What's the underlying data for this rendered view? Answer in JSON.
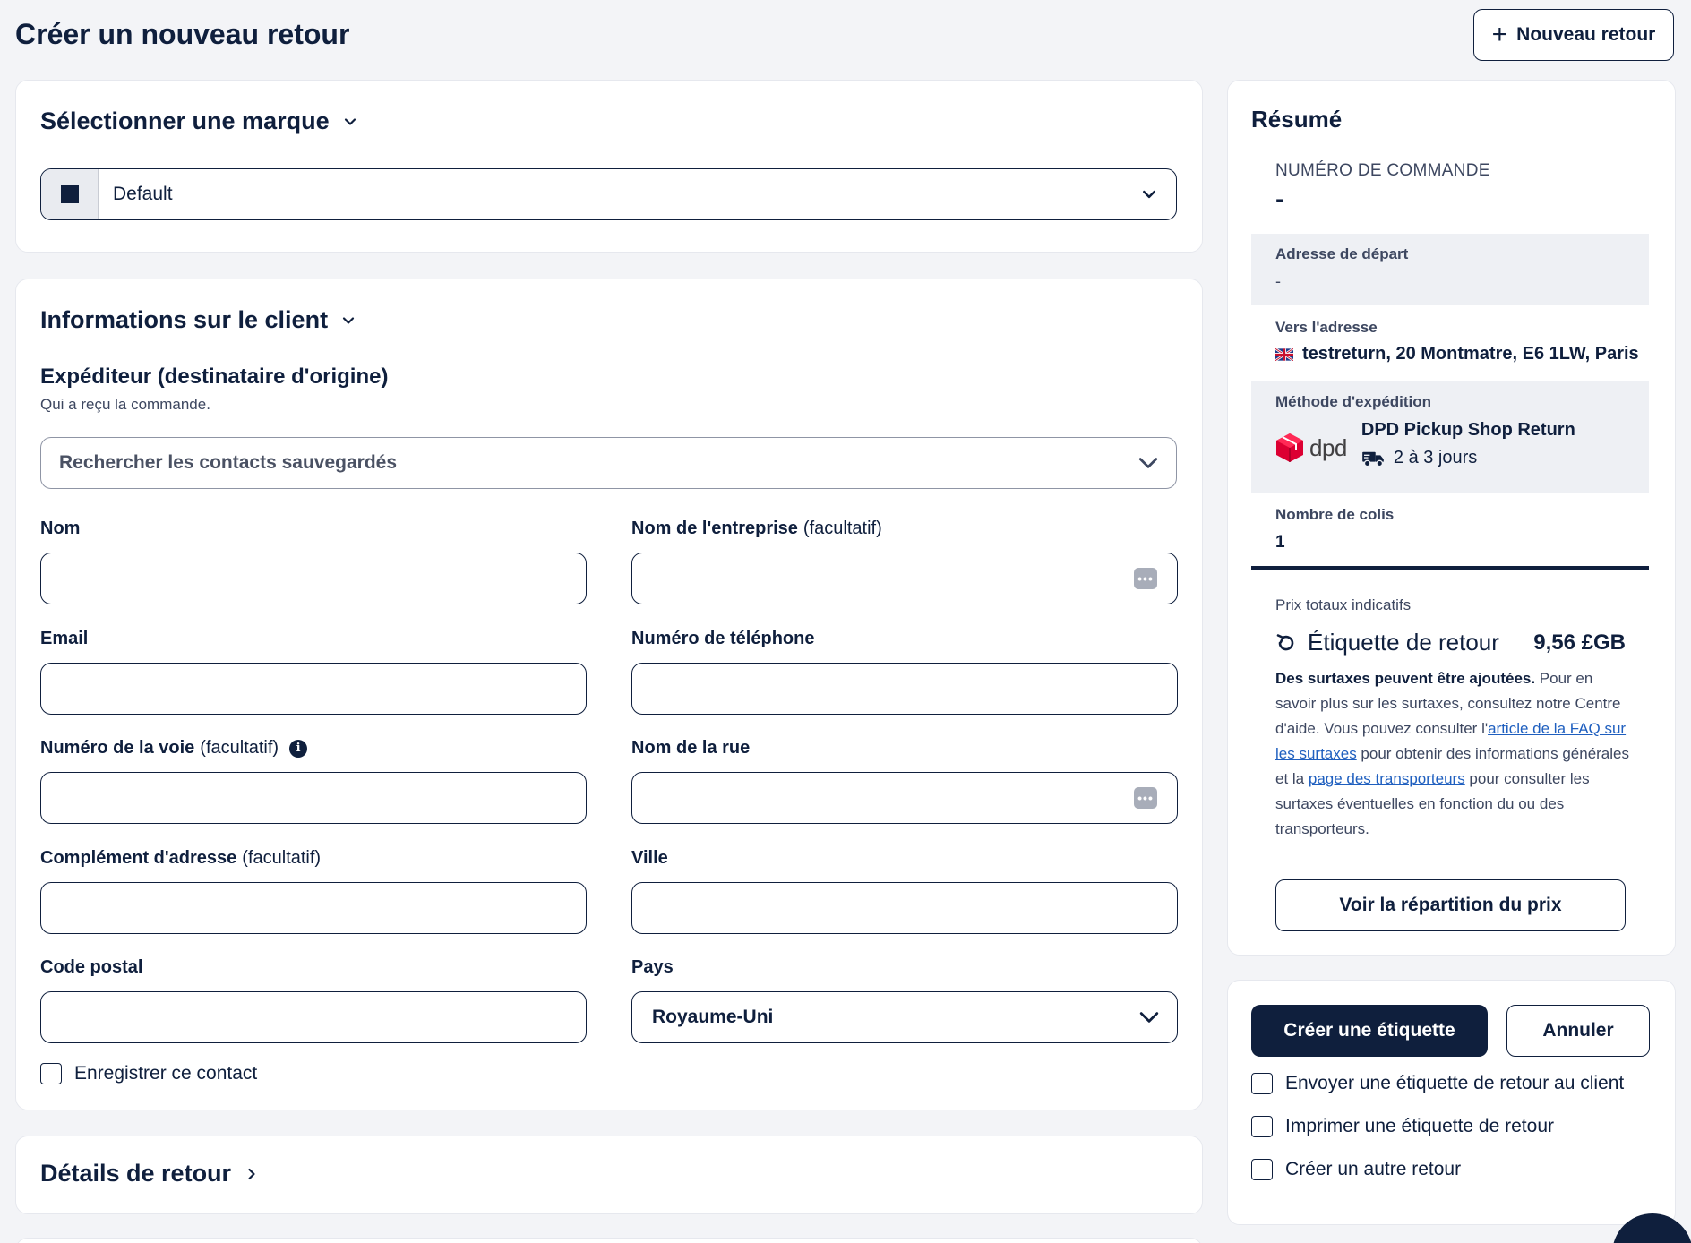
{
  "header": {
    "title": "Créer un nouveau retour",
    "new_return_label": "Nouveau retour"
  },
  "brand": {
    "section_title": "Sélectionner une marque",
    "selected": "Default",
    "swatch_color": "#0f1f3d"
  },
  "client": {
    "section_title": "Informations sur le client",
    "sender_title": "Expéditeur (destinataire d'origine)",
    "sender_desc": "Qui a reçu la commande.",
    "contacts_placeholder": "Rechercher les contacts sauvegardés",
    "optional_suffix": "(facultatif)",
    "fields": {
      "name": "Nom",
      "company": "Nom de l'entreprise",
      "email": "Email",
      "phone": "Numéro de téléphone",
      "street_number": "Numéro de la voie",
      "street_name": "Nom de la rue",
      "address_extra": "Complément d'adresse",
      "city": "Ville",
      "postal_code": "Code postal",
      "country": "Pays"
    },
    "country_value": "Royaume-Uni",
    "save_contact_label": "Enregistrer ce contact"
  },
  "details": {
    "section_title": "Détails de retour"
  },
  "summary": {
    "title": "Résumé",
    "order_number_label": "NUMÉRO DE COMMANDE",
    "order_number_value": "-",
    "from_label": "Adresse de départ",
    "from_value": "-",
    "to_label": "Vers l'adresse",
    "to_value": "testreturn, 20 Montmatre, E6 1LW, Paris",
    "shipping_label": "Méthode d'expédition",
    "carrier_logo_text": "dpd",
    "shipping_method": "DPD Pickup Shop Return",
    "shipping_time": "2 à 3 jours",
    "parcels_label": "Nombre de colis",
    "parcels_value": "1",
    "price_caption": "Prix totaux indicatifs",
    "price_name": "Étiquette de retour",
    "price_amount": "9,56 £GB",
    "surcharge_bold": "Des surtaxes peuvent être ajoutées.",
    "surcharge_text_1": " Pour en savoir plus sur les surtaxes, consultez notre Centre d'aide. Vous pouvez consulter l'",
    "surcharge_link_1": "article de la FAQ sur les surtaxes",
    "surcharge_text_2": " pour obtenir des informations générales et la ",
    "surcharge_link_2": "page des transporteurs",
    "surcharge_text_3": " pour consulter les surtaxes éventuelles en fonction du ou des transporteurs.",
    "breakdown_button": "Voir la répartition du prix"
  },
  "actions": {
    "create_label": "Créer une étiquette",
    "cancel_label": "Annuler",
    "options": [
      "Envoyer une étiquette de retour au client",
      "Imprimer une étiquette de retour",
      "Créer un autre retour"
    ]
  }
}
